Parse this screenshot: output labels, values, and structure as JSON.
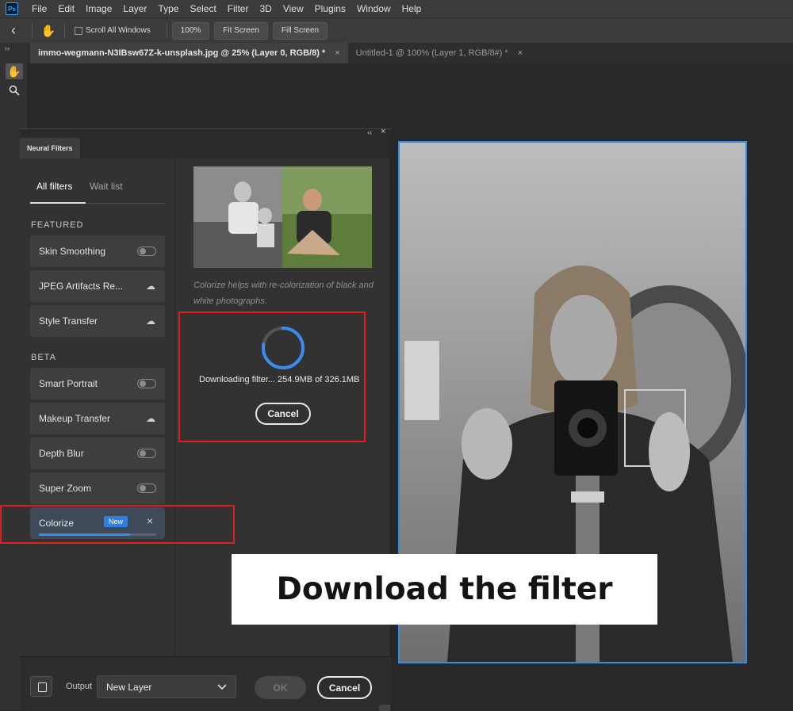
{
  "app": {
    "logo_text": "Ps"
  },
  "menu": [
    "File",
    "Edit",
    "Image",
    "Layer",
    "Type",
    "Select",
    "Filter",
    "3D",
    "View",
    "Plugins",
    "Window",
    "Help"
  ],
  "options": {
    "scroll_all_windows": "Scroll All Windows",
    "zoom_100": "100%",
    "fit_screen": "Fit Screen",
    "fill_screen": "Fill Screen"
  },
  "doc_tabs": [
    {
      "title": "immo-wegmann-N3IBsw67Z-k-unsplash.jpg @ 25% (Layer 0, RGB/8) *",
      "close": "×"
    },
    {
      "title": "Untitled-1 @ 100% (Layer 1, RGB/8#) *",
      "close": "×"
    }
  ],
  "panel": {
    "title": "Neural Filters",
    "collapse_glyph": "‹‹",
    "close_glyph": "×",
    "tabs": {
      "all_filters": "All filters",
      "wait_list": "Wait list"
    },
    "featured_label": "FEATURED",
    "beta_label": "BETA",
    "featured": [
      {
        "label": "Skin Smoothing",
        "control": "toggle"
      },
      {
        "label": "JPEG Artifacts Re...",
        "control": "cloud"
      },
      {
        "label": "Style Transfer",
        "control": "cloud"
      }
    ],
    "beta": [
      {
        "label": "Smart Portrait",
        "control": "toggle"
      },
      {
        "label": "Makeup Transfer",
        "control": "cloud"
      },
      {
        "label": "Depth Blur",
        "control": "toggle"
      },
      {
        "label": "Super Zoom",
        "control": "toggle"
      }
    ],
    "colorize": {
      "label": "Colorize",
      "badge": "New",
      "close": "×",
      "progress": 0.78
    },
    "description": "Colorize helps with re-colorization of black and white photographs.",
    "download": {
      "text": "Downloading filter... 254.9MB of 326.1MB",
      "cancel": "Cancel",
      "progress": 0.78
    },
    "footer": {
      "output_label": "Output",
      "output_value": "New Layer",
      "ok": "OK",
      "cancel": "Cancel"
    }
  },
  "caption": "Download the filter",
  "colors": {
    "accent_blue": "#2f7fe3",
    "highlight_red": "#e01e1e",
    "canvas_border": "#2e8ee8"
  }
}
